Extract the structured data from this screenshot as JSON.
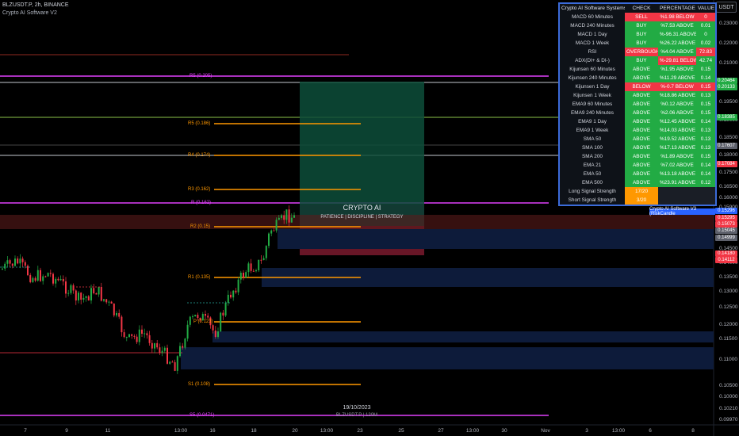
{
  "header": {
    "symbol_line": "BLZUSDT.P, 2h, BINANCE",
    "indicator_name": "Crypto AI Software V2",
    "currency_button": "USDT"
  },
  "price_axis": {
    "ticks": [
      "0.23000",
      "0.22000",
      "0.21000",
      "0.19500",
      "0.19000",
      "0.18500",
      "0.18000",
      "0.17500",
      "0.16500",
      "0.16000",
      "0.15900",
      "0.14500",
      "0.14000",
      "0.13500",
      "0.13000",
      "0.12500",
      "0.12000",
      "0.11500",
      "0.11000",
      "0.10500",
      "0.10000",
      "0.10210",
      "0.09970"
    ],
    "badges": [
      {
        "text": "0.20464",
        "color": "#22ab44"
      },
      {
        "text": "0.20133",
        "color": "#22ab44"
      },
      {
        "text": "0.18385",
        "color": "#22ab44"
      },
      {
        "text": "0.17607",
        "color": "#5d606b"
      },
      {
        "text": "0.17084",
        "color": "#f23645"
      },
      {
        "text": "0.15296",
        "color": "#2962ff"
      },
      {
        "text": "0.15295",
        "color": "#f23645"
      },
      {
        "text": "0.15073",
        "color": "#f23645"
      },
      {
        "text": "0.15045",
        "color": "#5d606b"
      },
      {
        "text": "0.14999",
        "color": "#5d606b"
      },
      {
        "text": "0.14180",
        "color": "#f23645"
      },
      {
        "text": "0.14112",
        "color": "#f23645"
      }
    ]
  },
  "time_axis": {
    "ticks": [
      "7",
      "9",
      "11",
      "13:00",
      "16",
      "18",
      "20",
      "13:00",
      "23",
      "25",
      "27",
      "13:00",
      "30",
      "Nov",
      "3",
      "13:00",
      "6",
      "8"
    ]
  },
  "levels": {
    "r5": "R5 (0.186)",
    "r4": "R4 (0.174)",
    "r3": "R3 (0.162)",
    "r2": "R2 (0.15)",
    "r1": "R1 (0.135)",
    "p": "P (0.123)",
    "s1": "S1 (0.108)",
    "magenta_top": "R5 (0.205)",
    "magenta_mid": "R (0.162)",
    "magenta_bottom": "S5 (0.0471)"
  },
  "banner": {
    "title": "CRYPTO AI",
    "subtitle": "PATIENCE  |  DISCIPLINE  |  STRATEGY"
  },
  "system_tag": "Crypto AI Software V3 (RiskCandle",
  "footer": {
    "date": "19/10/2023",
    "symbol": "BLZUSDT.P | 120M"
  },
  "table": {
    "headers": [
      "Crypto AI Software Systems",
      "CHECK",
      "PERCENTAGE",
      "VALUE"
    ],
    "rows": [
      {
        "name": "MACD 60 Minutes",
        "check": "SELL",
        "pct": "%1.98 BELOW",
        "value": "0"
      },
      {
        "name": "MACD 240 Minutes",
        "check": "BUY",
        "pct": "%7.53 ABOVE",
        "value": "0.01"
      },
      {
        "name": "MACD 1 Day",
        "check": "BUY",
        "pct": "%-96.31 ABOVE",
        "value": "0"
      },
      {
        "name": "MACD 1 Week",
        "check": "BUY",
        "pct": "%26.22 ABOVE",
        "value": "0.02"
      },
      {
        "name": "RSI",
        "check": "OVERBOUGHT",
        "pct": "%4.04 ABOVE",
        "value": "72.83"
      },
      {
        "name": "ADX(DI+ & DI-)",
        "check": "BUY",
        "pct": "%-29.81 BELOW",
        "value": "42.74"
      },
      {
        "name": "Kijunsen 60 Minutes",
        "check": "ABOVE",
        "pct": "%1.95 ABOVE",
        "value": "0.15"
      },
      {
        "name": "Kijunsen 240 Minutes",
        "check": "ABOVE",
        "pct": "%11.29 ABOVE",
        "value": "0.14"
      },
      {
        "name": "Kijunsen 1 Day",
        "check": "BELOW",
        "pct": "%-0.7 BELOW",
        "value": "0.15"
      },
      {
        "name": "Kijunsen 1 Week",
        "check": "ABOVE",
        "pct": "%18.86 ABOVE",
        "value": "0.13"
      },
      {
        "name": "EMA9 60 Minutes",
        "check": "ABOVE",
        "pct": "%0.12 ABOVE",
        "value": "0.15"
      },
      {
        "name": "EMA9 240 Minutes",
        "check": "ABOVE",
        "pct": "%2.06 ABOVE",
        "value": "0.15"
      },
      {
        "name": "EMA9 1 Day",
        "check": "ABOVE",
        "pct": "%12.45 ABOVE",
        "value": "0.14"
      },
      {
        "name": "EMA9 1 Week",
        "check": "ABOVE",
        "pct": "%14.03 ABOVE",
        "value": "0.13"
      },
      {
        "name": "SMA 50",
        "check": "ABOVE",
        "pct": "%19.52 ABOVE",
        "value": "0.13"
      },
      {
        "name": "SMA 100",
        "check": "ABOVE",
        "pct": "%17.13 ABOVE",
        "value": "0.13"
      },
      {
        "name": "SMA 200",
        "check": "ABOVE",
        "pct": "%1.89 ABOVE",
        "value": "0.15"
      },
      {
        "name": "EMA 21",
        "check": "ABOVE",
        "pct": "%7.02 ABOVE",
        "value": "0.14"
      },
      {
        "name": "EMA 50",
        "check": "ABOVE",
        "pct": "%13.18 ABOVE",
        "value": "0.14"
      },
      {
        "name": "EMA 500",
        "check": "ABOVE",
        "pct": "%23.91 ABOVE",
        "value": "0.12"
      }
    ],
    "long_signal": {
      "label": "Long Signal Strength",
      "value": "17/20"
    },
    "short_signal": {
      "label": "Short Signal Strength",
      "value": "3/20"
    }
  },
  "colors": {
    "up": "#22ab44",
    "down": "#f23645",
    "orange": "#ff9800",
    "magenta": "#e040fb",
    "zone_blue": "#0d1b3a",
    "accent": "#2962ff"
  }
}
